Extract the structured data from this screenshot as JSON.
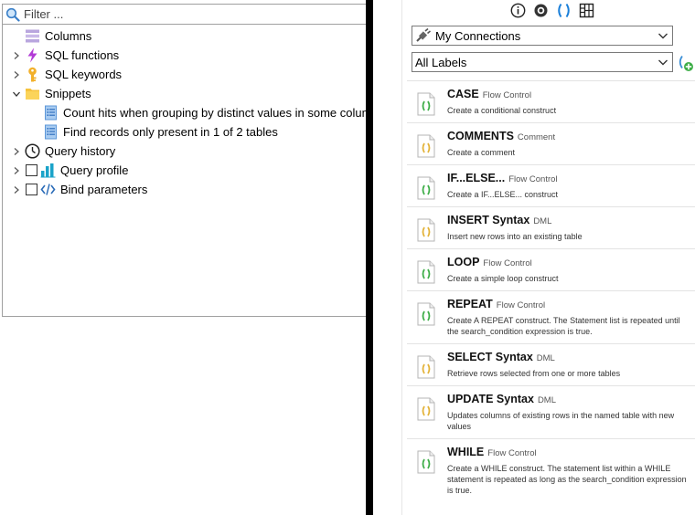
{
  "left": {
    "filter_placeholder": "Filter ...",
    "tree": [
      {
        "label": "Columns",
        "icon": "columns-icon",
        "expander": "none"
      },
      {
        "label": "SQL functions",
        "icon": "lightning-icon",
        "expander": "collapsed"
      },
      {
        "label": "SQL keywords",
        "icon": "key-icon",
        "expander": "collapsed"
      },
      {
        "label": "Snippets",
        "icon": "folder-icon",
        "expander": "expanded"
      },
      {
        "label": "Count hits when grouping by distinct values in some column",
        "icon": "document-icon",
        "expander": "none"
      },
      {
        "label": "Find records only present in 1 of 2 tables",
        "icon": "document-icon",
        "expander": "none"
      },
      {
        "label": "Query history",
        "icon": "clock-icon",
        "expander": "collapsed"
      },
      {
        "label": "Query profile",
        "icon": "bar-chart-icon",
        "expander": "collapsed",
        "checkbox": false
      },
      {
        "label": "Bind parameters",
        "icon": "code-tag-icon",
        "expander": "collapsed",
        "checkbox": false
      }
    ]
  },
  "right": {
    "toolbar": [
      "info-icon",
      "eye-icon",
      "parentheses-icon",
      "grid-icon"
    ],
    "connection": {
      "value": "My Connections"
    },
    "labels": {
      "value": "All Labels"
    },
    "snippets": [
      {
        "name": "CASE",
        "category": "Flow Control",
        "description": "Create a conditional construct"
      },
      {
        "name": "COMMENTS",
        "category": "Comment",
        "description": "Create a comment"
      },
      {
        "name": "IF...ELSE...",
        "category": "Flow Control",
        "description": "Create a IF...ELSE... construct"
      },
      {
        "name": "INSERT Syntax",
        "category": "DML",
        "description": "Insert new rows into an existing table"
      },
      {
        "name": "LOOP",
        "category": "Flow Control",
        "description": "Create a simple loop construct"
      },
      {
        "name": "REPEAT",
        "category": "Flow Control",
        "description": "Create A REPEAT construct. The Statement list is repeated until the search_condition expression is true."
      },
      {
        "name": "SELECT Syntax",
        "category": "DML",
        "description": "Retrieve rows selected from one or more tables"
      },
      {
        "name": "UPDATE Syntax",
        "category": "DML",
        "description": "Updates columns of existing rows in the named table with new values"
      },
      {
        "name": "WHILE",
        "category": "Flow Control",
        "description": "Create a WHILE construct. The statement list within a WHILE statement is repeated as long as the search_condition expression is true."
      }
    ]
  }
}
